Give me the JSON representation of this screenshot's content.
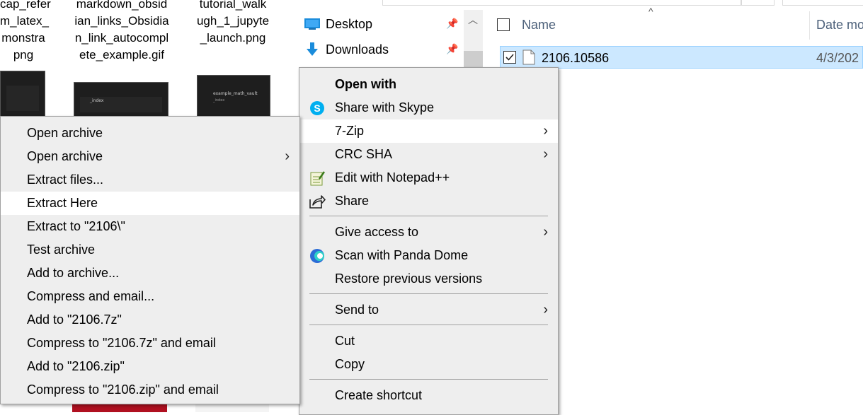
{
  "thumbnails": [
    {
      "lines": [
        "cap_refer",
        "m_latex_",
        "monstra",
        "png"
      ]
    },
    {
      "lines": [
        "markdown_obsid",
        "ian_links_Obsidia",
        "n_link_autocompl",
        "ete_example.gif"
      ]
    },
    {
      "lines": [
        "tutorial_walk",
        "ugh_1_jupyte",
        "_launch.png"
      ]
    }
  ],
  "thumb_texts": {
    "t2": "_index",
    "t3a": "example_math_vault",
    "t3b": "_index"
  },
  "nav": {
    "items": [
      {
        "label": "Desktop",
        "icon": "desktop-icon"
      },
      {
        "label": "Downloads",
        "icon": "downloads-icon"
      }
    ]
  },
  "filelist": {
    "col_name": "Name",
    "col_date": "Date mo",
    "rows": [
      {
        "name": "2106.10586",
        "date": "4/3/202",
        "selected": true
      }
    ]
  },
  "menu_7zip": {
    "items": [
      {
        "label": "Open archive"
      },
      {
        "label": "Open archive",
        "submenu": true
      },
      {
        "label": "Extract files..."
      },
      {
        "label": "Extract Here",
        "hover": true
      },
      {
        "label": "Extract to \"2106\\\""
      },
      {
        "label": "Test archive"
      },
      {
        "label": "Add to archive..."
      },
      {
        "label": "Compress and email..."
      },
      {
        "label": "Add to \"2106.7z\""
      },
      {
        "label": "Compress to \"2106.7z\" and email"
      },
      {
        "label": "Add to \"2106.zip\""
      },
      {
        "label": "Compress to \"2106.zip\" and email"
      }
    ]
  },
  "menu_main": {
    "open_with": "Open with",
    "share_skype": "Share with Skype",
    "seven_zip": "7-Zip",
    "crc_sha": "CRC SHA",
    "edit_notepad": "Edit with Notepad++",
    "share": "Share",
    "give_access": "Give access to",
    "scan_panda": "Scan with Panda Dome",
    "restore": "Restore previous versions",
    "send_to": "Send to",
    "cut": "Cut",
    "copy": "Copy",
    "create_shortcut": "Create shortcut"
  },
  "colors": {
    "selection": "#cce8ff",
    "menu_bg": "#eeeeee",
    "skype": "#00aff0",
    "accent": "#0078d7"
  }
}
